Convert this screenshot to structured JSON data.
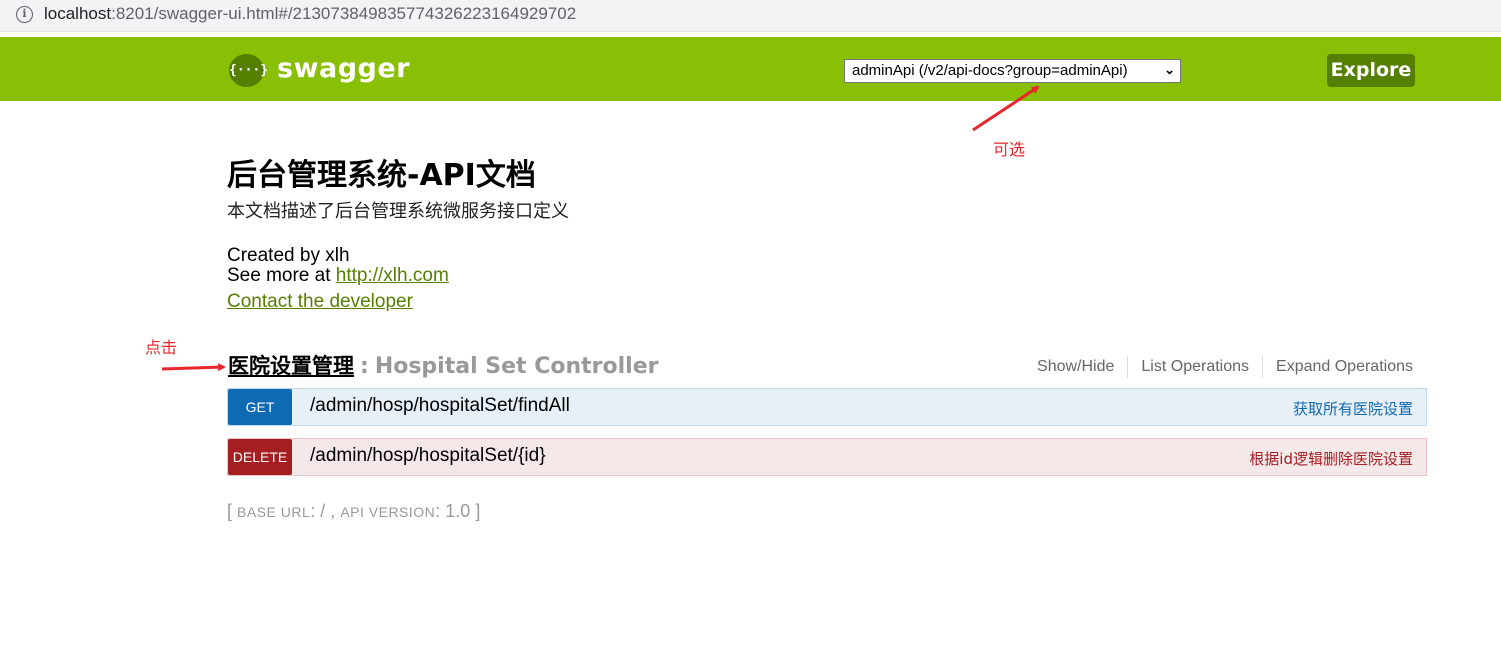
{
  "browser": {
    "url_host": "localhost",
    "url_rest": ":8201/swagger-ui.html#/213073849835774326223164929702"
  },
  "header": {
    "logo_symbol": "{···}",
    "logo_text": "swagger",
    "api_select_value": "adminApi (/v2/api-docs?group=adminApi)",
    "explore_label": "Explore",
    "brand_color": "#89bf04"
  },
  "info": {
    "title": "后台管理系统-API文档",
    "description": "本文档描述了后台管理系统微服务接口定义",
    "created_by": "Created by xlh",
    "see_more_prefix": "See more at ",
    "see_more_link": "http://xlh.com",
    "contact": "Contact the developer"
  },
  "resource": {
    "name": "医院设置管理",
    "separator": ":",
    "description": "Hospital Set Controller",
    "options": [
      "Show/Hide",
      "List Operations",
      "Expand Operations"
    ]
  },
  "operations": [
    {
      "method": "GET",
      "path": "/admin/hosp/hospitalSet/findAll",
      "summary": "获取所有医院设置",
      "color": "#0f6ab4"
    },
    {
      "method": "DELETE",
      "path": "/admin/hosp/hospitalSet/{id}",
      "summary": "根据id逻辑删除医院设置",
      "color": "#a41e22"
    }
  ],
  "footer": {
    "open": "[",
    "base_url_label": "BASE URL",
    "base_url_value": ": / ,",
    "api_version_label": "API VERSION",
    "api_version_value": ": 1.0",
    "close": "]"
  },
  "annotations": {
    "selectable": "可选",
    "click": "点击",
    "color": "#e8262d"
  }
}
